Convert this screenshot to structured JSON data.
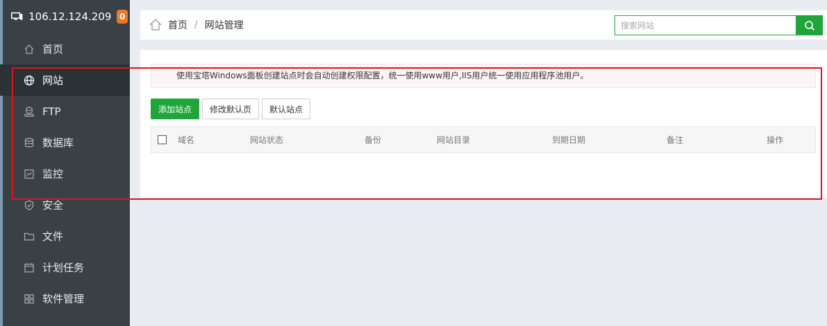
{
  "sidebar": {
    "host": "106.12.124.209",
    "badge": "0",
    "items": [
      {
        "label": "首页",
        "icon": "home-icon"
      },
      {
        "label": "网站",
        "icon": "globe-icon",
        "active": true
      },
      {
        "label": "FTP",
        "icon": "ftp-icon"
      },
      {
        "label": "数据库",
        "icon": "database-icon"
      },
      {
        "label": "监控",
        "icon": "monitor-chart-icon"
      },
      {
        "label": "安全",
        "icon": "shield-icon"
      },
      {
        "label": "文件",
        "icon": "folder-icon"
      },
      {
        "label": "计划任务",
        "icon": "calendar-icon"
      },
      {
        "label": "软件管理",
        "icon": "grid-icon"
      }
    ]
  },
  "breadcrumb": {
    "home": "首页",
    "separator": "/",
    "current": "网站管理"
  },
  "search": {
    "placeholder": "搜索网站"
  },
  "notice": "使用宝塔Windows面板创建站点时会自动创建权限配置，统一使用www用户,IIS用户统一使用应用程序池用户。",
  "actions": {
    "add_site": "添加站点",
    "edit_default_page": "修改默认页",
    "default_site": "默认站点"
  },
  "table": {
    "columns": [
      "域名",
      "网站状态",
      "备份",
      "网站目录",
      "到期日期",
      "备注",
      "操作"
    ]
  },
  "colors": {
    "sidebar_bg": "#394146",
    "accent_green": "#20a53a",
    "badge_orange": "#f0772a",
    "highlight_red": "#d9161c"
  }
}
